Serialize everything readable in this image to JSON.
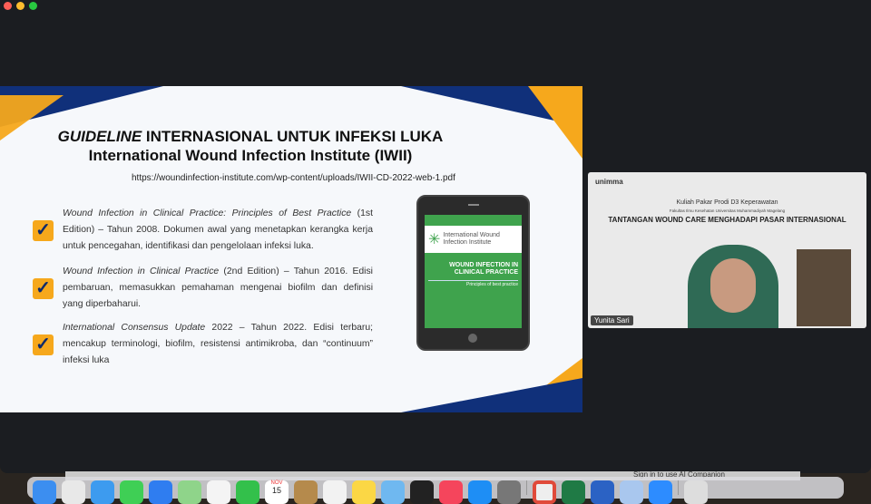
{
  "window": {
    "controls": [
      "close",
      "minimize",
      "maximize"
    ],
    "colors": {
      "close": "#fe5f57",
      "minimize": "#febc2e",
      "maximize": "#28c840"
    }
  },
  "slide": {
    "title_italic": "GUIDELINE",
    "title_rest": " INTERNASIONAL UNTUK INFEKSI LUKA",
    "subtitle": "International Wound Infection Institute (IWII)",
    "url": "https://woundinfection-institute.com/wp-content/uploads/IWII-CD-2022-web-1.pdf",
    "items": [
      {
        "italic": "Wound Infection in Clinical Practice: Principles of Best Practice",
        "rest": " (1st Edition) – Tahun 2008. Dokumen awal yang menetapkan kerangka kerja untuk pencegahan, identifikasi dan pengelolaan infeksi luka."
      },
      {
        "italic": "Wound Infection in Clinical Practice",
        "rest": " (2nd Edition) – Tahun 2016. Edisi pembaruan, memasukkan pemahaman mengenai biofilm dan definisi yang diperbaharui."
      },
      {
        "italic": "International Consensus Update",
        "rest": " 2022 – Tahun 2022. Edisi terbaru; mencakup terminologi, biofilm, resistensi antimikroba, dan “continuum” infeksi luka"
      }
    ],
    "book": {
      "org": "International Wound Infection Institute",
      "title": "WOUND INFECTION IN CLINICAL PRACTICE",
      "sub": "Principles of best practice"
    },
    "colors": {
      "navy": "#10307a",
      "orange": "#f6a81c",
      "green": "#3fa34d"
    }
  },
  "video": {
    "logo": "unimma",
    "header": "Kuliah Pakar Prodi D3 Keperawatan",
    "faculty": "Fakultas Ilmu Kesehatan Universitas Muhammadiyah Magelang",
    "topic": "TANTANGAN WOUND CARE MENGHADAPI PASAR INTERNASIONAL",
    "participant": "Yunita Sari"
  },
  "taskbar_hint": "Sign in to use AI Companion",
  "dock": {
    "calendar_month": "NOV",
    "calendar_day": "15",
    "apps": [
      "finder",
      "launchpad",
      "safari",
      "messages",
      "mail",
      "maps",
      "photos",
      "facetime",
      "calendar",
      "notes-app",
      "contacts",
      "notes",
      "preview",
      "tv",
      "music",
      "app-store",
      "settings",
      "chrome",
      "excel",
      "word",
      "files",
      "zoom",
      "trash"
    ]
  }
}
